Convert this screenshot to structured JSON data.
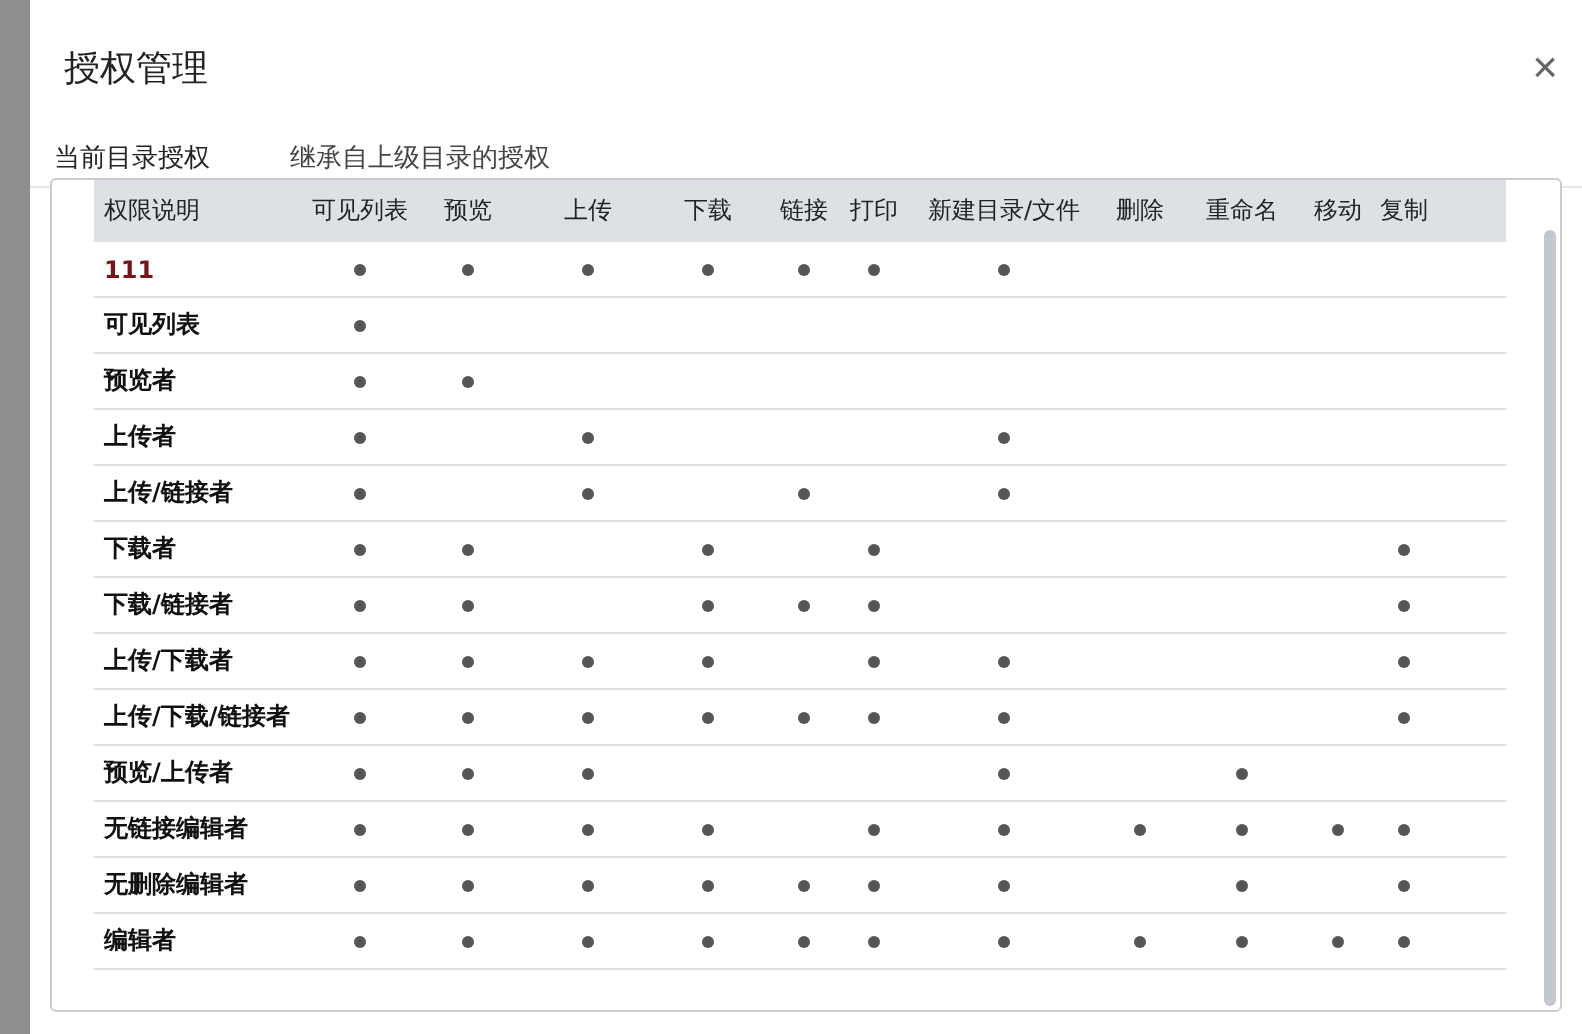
{
  "dialog": {
    "title": "授权管理",
    "close": "×"
  },
  "tabs": [
    {
      "label": "当前目录授权",
      "selected": true
    },
    {
      "label": "继承自上级目录的授权",
      "selected": false
    }
  ],
  "table": {
    "columns": [
      "权限说明",
      "可见列表",
      "预览",
      "上传",
      "下载",
      "链接",
      "打印",
      "新建目录/文件",
      "删除",
      "重命名",
      "移动",
      "复制"
    ],
    "rows": [
      {
        "name": "111",
        "color": "#7a1414",
        "cells": [
          true,
          true,
          true,
          true,
          true,
          true,
          true,
          false,
          false,
          false,
          false
        ]
      },
      {
        "name": "可见列表",
        "color": "#111111",
        "cells": [
          true,
          false,
          false,
          false,
          false,
          false,
          false,
          false,
          false,
          false,
          false
        ]
      },
      {
        "name": "预览者",
        "color": "#111111",
        "cells": [
          true,
          true,
          false,
          false,
          false,
          false,
          false,
          false,
          false,
          false,
          false
        ]
      },
      {
        "name": "上传者",
        "color": "#111111",
        "cells": [
          true,
          false,
          true,
          false,
          false,
          false,
          true,
          false,
          false,
          false,
          false
        ]
      },
      {
        "name": "上传/链接者",
        "color": "#111111",
        "cells": [
          true,
          false,
          true,
          false,
          true,
          false,
          true,
          false,
          false,
          false,
          false
        ]
      },
      {
        "name": "下载者",
        "color": "#111111",
        "cells": [
          true,
          true,
          false,
          true,
          false,
          true,
          false,
          false,
          false,
          false,
          true
        ]
      },
      {
        "name": "下载/链接者",
        "color": "#111111",
        "cells": [
          true,
          true,
          false,
          true,
          true,
          true,
          false,
          false,
          false,
          false,
          true
        ]
      },
      {
        "name": "上传/下载者",
        "color": "#111111",
        "cells": [
          true,
          true,
          true,
          true,
          false,
          true,
          true,
          false,
          false,
          false,
          true
        ]
      },
      {
        "name": "上传/下载/链接者",
        "color": "#111111",
        "cells": [
          true,
          true,
          true,
          true,
          true,
          true,
          true,
          false,
          false,
          false,
          true
        ]
      },
      {
        "name": "预览/上传者",
        "color": "#111111",
        "cells": [
          true,
          true,
          true,
          false,
          false,
          false,
          true,
          false,
          true,
          false,
          false
        ]
      },
      {
        "name": "无链接编辑者",
        "color": "#111111",
        "cells": [
          true,
          true,
          true,
          true,
          false,
          true,
          true,
          true,
          true,
          true,
          true
        ]
      },
      {
        "name": "无删除编辑者",
        "color": "#111111",
        "cells": [
          true,
          true,
          true,
          true,
          true,
          true,
          true,
          false,
          true,
          false,
          true
        ]
      },
      {
        "name": "编辑者",
        "color": "#111111",
        "cells": [
          true,
          true,
          true,
          true,
          true,
          true,
          true,
          true,
          true,
          true,
          true
        ]
      }
    ]
  }
}
